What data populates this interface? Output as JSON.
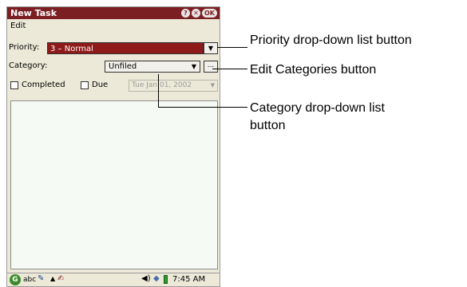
{
  "window": {
    "title": "New Task",
    "help_label": "?",
    "close_label": "✕",
    "ok_label": "OK"
  },
  "menu": {
    "edit": "Edit"
  },
  "form": {
    "priority_label": "Priority:",
    "priority_value": "3 – Normal",
    "category_label": "Category:",
    "category_value": "Unfiled",
    "edit_categories_label": "...",
    "completed_label": "Completed",
    "due_label": "Due",
    "due_date_value": "Tue Jan 01, 2002"
  },
  "taskbar": {
    "time": "7:45 AM",
    "input_mode": "abc"
  },
  "callouts": {
    "priority": "Priority drop-down list button",
    "edit_categories": "Edit Categories button",
    "category_line1": "Category drop-down list",
    "category_line2": "button"
  },
  "colors": {
    "title_bar": "#7b1f22",
    "priority_highlight": "#8e1a1a",
    "background": "#ece9d8"
  },
  "icons": [
    "help-icon",
    "close-icon",
    "dropdown-arrow-icon",
    "start-logo-icon",
    "pen-icon",
    "note-icon",
    "volume-icon",
    "diamond-icon",
    "battery-icon"
  ]
}
